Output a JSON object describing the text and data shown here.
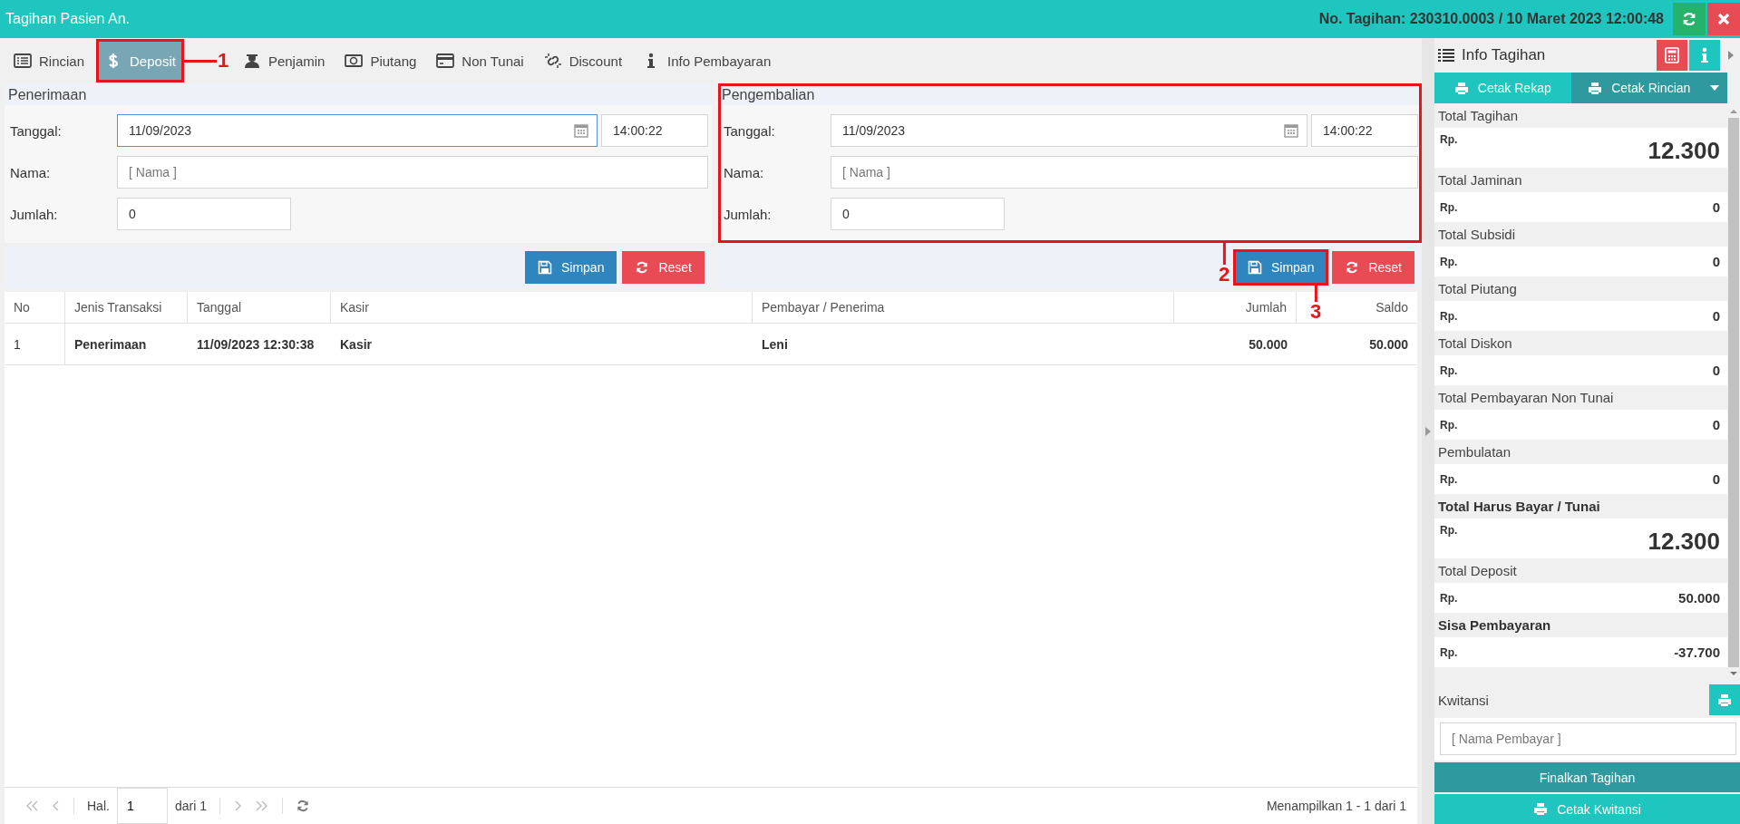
{
  "header": {
    "title": "Tagihan Pasien An.",
    "bill_info": "No. Tagihan: 230310.0003 / 10 Maret 2023 12:00:48"
  },
  "tabs": [
    {
      "label": "Rincian",
      "selected": false
    },
    {
      "label": "Deposit",
      "selected": true,
      "callout": "1"
    },
    {
      "label": "Penjamin",
      "selected": false
    },
    {
      "label": "Piutang",
      "selected": false
    },
    {
      "label": "Non Tunai",
      "selected": false
    },
    {
      "label": "Discount",
      "selected": false
    },
    {
      "label": "Info Pembayaran",
      "selected": false
    }
  ],
  "forms": [
    {
      "title": "Penerimaan",
      "date_label": "Tanggal:",
      "date": "11/09/2023",
      "date_focused": true,
      "time": "14:00:22",
      "name_label": "Nama:",
      "name_placeholder": "[ Nama ]",
      "amount_label": "Jumlah:",
      "amount": "0",
      "save": "Simpan",
      "reset": "Reset"
    },
    {
      "title": "Pengembalian",
      "callout": "2",
      "date_label": "Tanggal:",
      "date": "11/09/2023",
      "date_focused": false,
      "time": "14:00:22",
      "name_label": "Nama:",
      "name_placeholder": "[ Nama ]",
      "amount_label": "Jumlah:",
      "amount": "0",
      "save": "Simpan",
      "save_callout": "3",
      "reset": "Reset"
    }
  ],
  "table": {
    "columns": [
      "No",
      "Jenis Transaksi",
      "Tanggal",
      "Kasir",
      "Pembayar / Penerima",
      "Jumlah",
      "Saldo"
    ],
    "rows": [
      [
        "1",
        "Penerimaan",
        "11/09/2023 12:30:38",
        "Kasir",
        "Leni",
        "50.000",
        "50.000"
      ]
    ]
  },
  "pager": {
    "page_label": "Hal.",
    "page": "1",
    "of": "dari 1",
    "summary": "Menampilkan 1 - 1 dari 1"
  },
  "info": {
    "title": "Info Tagihan",
    "print_buttons": [
      "Cetak Rekap",
      "Cetak Rincian"
    ],
    "totals": [
      {
        "label": "Total Tagihan",
        "currency": "Rp.",
        "value": "12.300",
        "kind": "big"
      },
      {
        "label": "Total Jaminan",
        "currency": "Rp.",
        "value": "0",
        "kind": "plain"
      },
      {
        "label": "Total Subsidi",
        "currency": "Rp.",
        "value": "0",
        "kind": "plain"
      },
      {
        "label": "Total Piutang",
        "currency": "Rp.",
        "value": "0",
        "kind": "plain"
      },
      {
        "label": "Total Diskon",
        "currency": "Rp.",
        "value": "0",
        "kind": "plain"
      },
      {
        "label": "Total Pembayaran Non Tunai",
        "currency": "Rp.",
        "value": "0",
        "kind": "plain"
      },
      {
        "label": "Pembulatan",
        "currency": "Rp.",
        "value": "0",
        "kind": "plain"
      },
      {
        "label": "Total Harus Bayar / Tunai",
        "currency": "Rp.",
        "value": "12.300",
        "kind": "grand"
      },
      {
        "label": "Total Deposit",
        "currency": "Rp.",
        "value": "50.000",
        "kind": "plain"
      },
      {
        "label": "Sisa Pembayaran",
        "currency": "Rp.",
        "value": "-37.700",
        "kind": "balance"
      }
    ],
    "receipt_label": "Kwitansi",
    "payer_placeholder": "[ Nama Pembayar ]",
    "finalize": "Finalkan Tagihan",
    "print_receipt": "Cetak Kwitansi"
  }
}
